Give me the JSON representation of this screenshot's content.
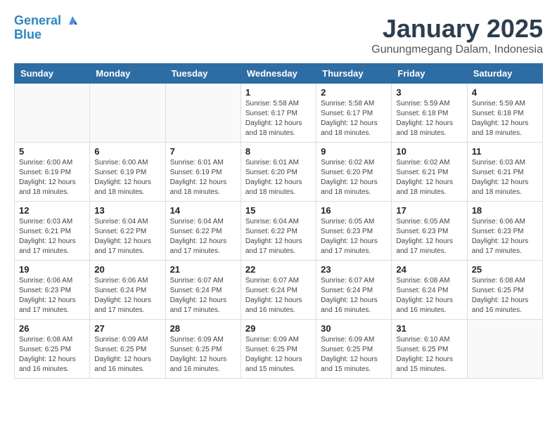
{
  "logo": {
    "line1": "General",
    "line2": "Blue"
  },
  "title": "January 2025",
  "subtitle": "Gunungmegang Dalam, Indonesia",
  "weekdays": [
    "Sunday",
    "Monday",
    "Tuesday",
    "Wednesday",
    "Thursday",
    "Friday",
    "Saturday"
  ],
  "weeks": [
    [
      {
        "day": "",
        "info": ""
      },
      {
        "day": "",
        "info": ""
      },
      {
        "day": "",
        "info": ""
      },
      {
        "day": "1",
        "info": "Sunrise: 5:58 AM\nSunset: 6:17 PM\nDaylight: 12 hours\nand 18 minutes."
      },
      {
        "day": "2",
        "info": "Sunrise: 5:58 AM\nSunset: 6:17 PM\nDaylight: 12 hours\nand 18 minutes."
      },
      {
        "day": "3",
        "info": "Sunrise: 5:59 AM\nSunset: 6:18 PM\nDaylight: 12 hours\nand 18 minutes."
      },
      {
        "day": "4",
        "info": "Sunrise: 5:59 AM\nSunset: 6:18 PM\nDaylight: 12 hours\nand 18 minutes."
      }
    ],
    [
      {
        "day": "5",
        "info": "Sunrise: 6:00 AM\nSunset: 6:19 PM\nDaylight: 12 hours\nand 18 minutes."
      },
      {
        "day": "6",
        "info": "Sunrise: 6:00 AM\nSunset: 6:19 PM\nDaylight: 12 hours\nand 18 minutes."
      },
      {
        "day": "7",
        "info": "Sunrise: 6:01 AM\nSunset: 6:19 PM\nDaylight: 12 hours\nand 18 minutes."
      },
      {
        "day": "8",
        "info": "Sunrise: 6:01 AM\nSunset: 6:20 PM\nDaylight: 12 hours\nand 18 minutes."
      },
      {
        "day": "9",
        "info": "Sunrise: 6:02 AM\nSunset: 6:20 PM\nDaylight: 12 hours\nand 18 minutes."
      },
      {
        "day": "10",
        "info": "Sunrise: 6:02 AM\nSunset: 6:21 PM\nDaylight: 12 hours\nand 18 minutes."
      },
      {
        "day": "11",
        "info": "Sunrise: 6:03 AM\nSunset: 6:21 PM\nDaylight: 12 hours\nand 18 minutes."
      }
    ],
    [
      {
        "day": "12",
        "info": "Sunrise: 6:03 AM\nSunset: 6:21 PM\nDaylight: 12 hours\nand 17 minutes."
      },
      {
        "day": "13",
        "info": "Sunrise: 6:04 AM\nSunset: 6:22 PM\nDaylight: 12 hours\nand 17 minutes."
      },
      {
        "day": "14",
        "info": "Sunrise: 6:04 AM\nSunset: 6:22 PM\nDaylight: 12 hours\nand 17 minutes."
      },
      {
        "day": "15",
        "info": "Sunrise: 6:04 AM\nSunset: 6:22 PM\nDaylight: 12 hours\nand 17 minutes."
      },
      {
        "day": "16",
        "info": "Sunrise: 6:05 AM\nSunset: 6:23 PM\nDaylight: 12 hours\nand 17 minutes."
      },
      {
        "day": "17",
        "info": "Sunrise: 6:05 AM\nSunset: 6:23 PM\nDaylight: 12 hours\nand 17 minutes."
      },
      {
        "day": "18",
        "info": "Sunrise: 6:06 AM\nSunset: 6:23 PM\nDaylight: 12 hours\nand 17 minutes."
      }
    ],
    [
      {
        "day": "19",
        "info": "Sunrise: 6:06 AM\nSunset: 6:23 PM\nDaylight: 12 hours\nand 17 minutes."
      },
      {
        "day": "20",
        "info": "Sunrise: 6:06 AM\nSunset: 6:24 PM\nDaylight: 12 hours\nand 17 minutes."
      },
      {
        "day": "21",
        "info": "Sunrise: 6:07 AM\nSunset: 6:24 PM\nDaylight: 12 hours\nand 17 minutes."
      },
      {
        "day": "22",
        "info": "Sunrise: 6:07 AM\nSunset: 6:24 PM\nDaylight: 12 hours\nand 16 minutes."
      },
      {
        "day": "23",
        "info": "Sunrise: 6:07 AM\nSunset: 6:24 PM\nDaylight: 12 hours\nand 16 minutes."
      },
      {
        "day": "24",
        "info": "Sunrise: 6:08 AM\nSunset: 6:24 PM\nDaylight: 12 hours\nand 16 minutes."
      },
      {
        "day": "25",
        "info": "Sunrise: 6:08 AM\nSunset: 6:25 PM\nDaylight: 12 hours\nand 16 minutes."
      }
    ],
    [
      {
        "day": "26",
        "info": "Sunrise: 6:08 AM\nSunset: 6:25 PM\nDaylight: 12 hours\nand 16 minutes."
      },
      {
        "day": "27",
        "info": "Sunrise: 6:09 AM\nSunset: 6:25 PM\nDaylight: 12 hours\nand 16 minutes."
      },
      {
        "day": "28",
        "info": "Sunrise: 6:09 AM\nSunset: 6:25 PM\nDaylight: 12 hours\nand 16 minutes."
      },
      {
        "day": "29",
        "info": "Sunrise: 6:09 AM\nSunset: 6:25 PM\nDaylight: 12 hours\nand 15 minutes."
      },
      {
        "day": "30",
        "info": "Sunrise: 6:09 AM\nSunset: 6:25 PM\nDaylight: 12 hours\nand 15 minutes."
      },
      {
        "day": "31",
        "info": "Sunrise: 6:10 AM\nSunset: 6:25 PM\nDaylight: 12 hours\nand 15 minutes."
      },
      {
        "day": "",
        "info": ""
      }
    ]
  ]
}
